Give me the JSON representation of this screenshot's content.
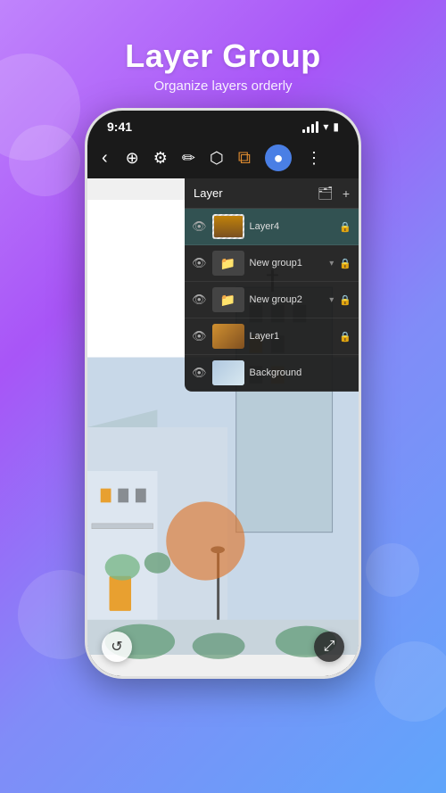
{
  "header": {
    "title": "Layer Group",
    "subtitle": "Organize layers orderly"
  },
  "status_bar": {
    "time": "9:41",
    "signal": "full",
    "wifi": true,
    "battery": "full"
  },
  "toolbar": {
    "back_label": "‹",
    "tools": [
      "add",
      "settings",
      "pen",
      "eraser",
      "layer",
      "color",
      "more"
    ]
  },
  "layer_panel": {
    "title": "Layer",
    "add_folder_icon": "📁",
    "add_layer_icon": "+",
    "layers": [
      {
        "name": "Layer4",
        "type": "layer",
        "visible": true,
        "selected": true,
        "locked": true,
        "thumb": "city-tower"
      },
      {
        "name": "New group1",
        "type": "group",
        "visible": true,
        "selected": false,
        "locked": true,
        "thumb": "folder",
        "has_chevron": true
      },
      {
        "name": "New group2",
        "type": "group",
        "visible": true,
        "selected": false,
        "locked": true,
        "thumb": "folder",
        "has_chevron": true
      },
      {
        "name": "Layer1",
        "type": "layer",
        "visible": true,
        "selected": false,
        "locked": true,
        "thumb": "city-thumb"
      },
      {
        "name": "Background",
        "type": "layer",
        "visible": true,
        "selected": false,
        "locked": false,
        "thumb": "bg"
      }
    ]
  },
  "bottom_buttons": {
    "undo_label": "↺",
    "expand_label": "⤢"
  }
}
